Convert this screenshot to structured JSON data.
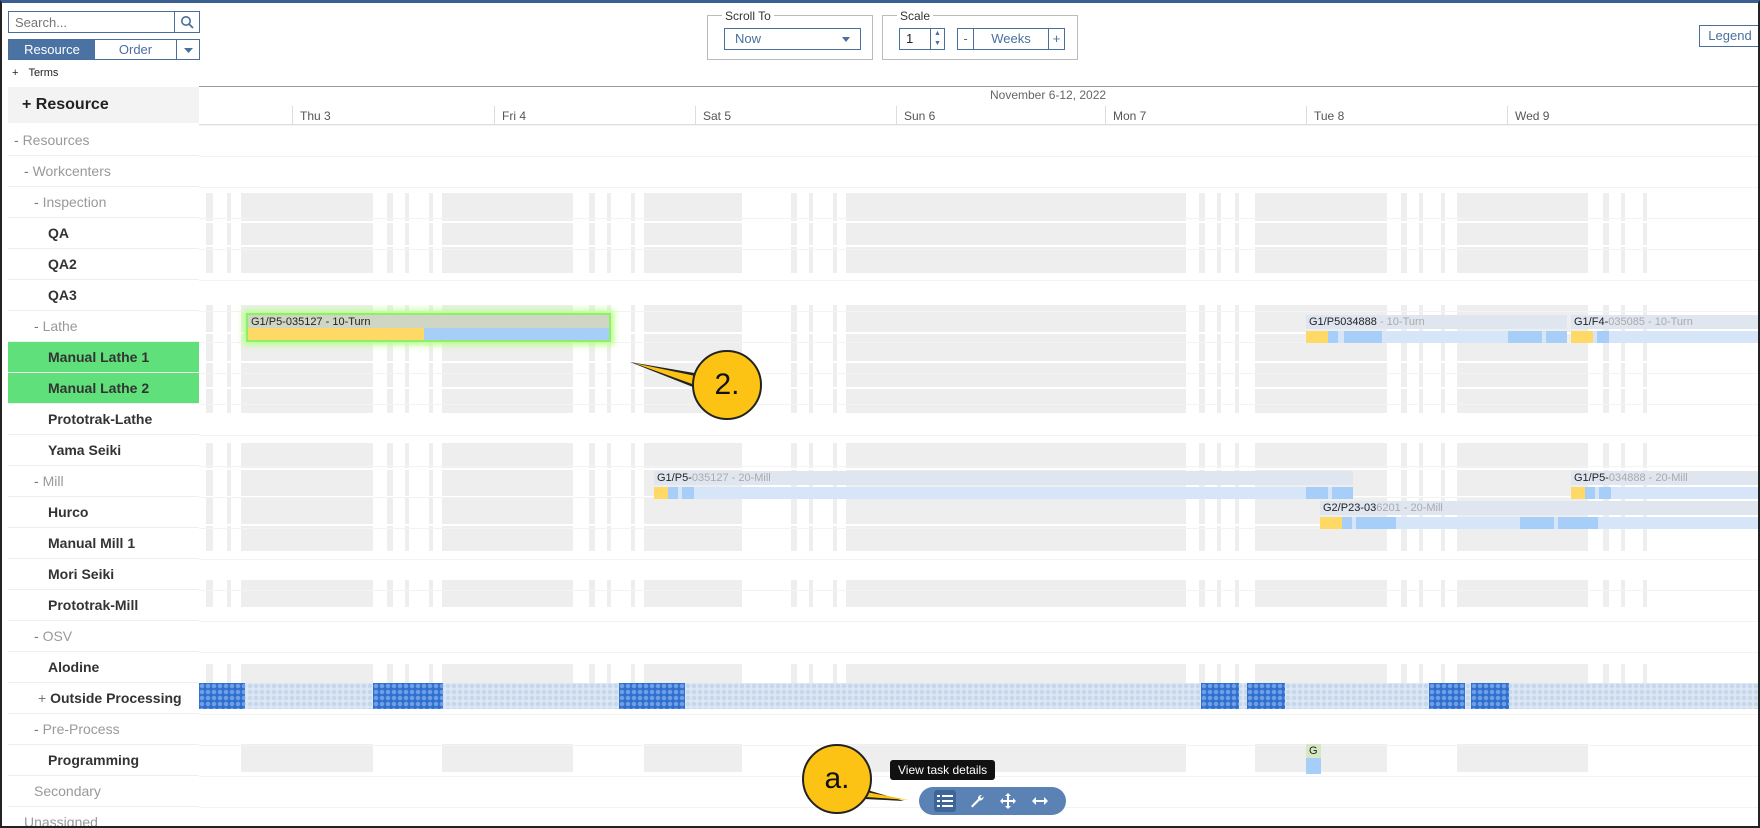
{
  "search": {
    "placeholder": "Search..."
  },
  "view_toggle": {
    "resource_label": "Resource",
    "order_label": "Order"
  },
  "terms_label": "Terms",
  "resource_header": "Resource",
  "tree": [
    {
      "label": "Resources",
      "type": "group",
      "prefix": "-"
    },
    {
      "label": "Workcenters",
      "type": "group",
      "prefix": "-"
    },
    {
      "label": "Inspection",
      "type": "group",
      "prefix": "-"
    },
    {
      "label": "QA",
      "type": "leaf"
    },
    {
      "label": "QA2",
      "type": "leaf"
    },
    {
      "label": "QA3",
      "type": "leaf"
    },
    {
      "label": "Lathe",
      "type": "group",
      "prefix": "-"
    },
    {
      "label": "Manual Lathe 1",
      "type": "leaf",
      "highlighted": true
    },
    {
      "label": "Manual Lathe 2",
      "type": "leaf",
      "highlighted": true
    },
    {
      "label": "Prototrak-Lathe",
      "type": "leaf"
    },
    {
      "label": "Yama Seiki",
      "type": "leaf"
    },
    {
      "label": "Mill",
      "type": "group",
      "prefix": "-"
    },
    {
      "label": "Hurco",
      "type": "leaf"
    },
    {
      "label": "Manual Mill 1",
      "type": "leaf"
    },
    {
      "label": "Mori Seiki",
      "type": "leaf"
    },
    {
      "label": "Prototrak-Mill",
      "type": "leaf"
    },
    {
      "label": "OSV",
      "type": "group",
      "prefix": "-"
    },
    {
      "label": "Alodine",
      "type": "leaf"
    },
    {
      "label": "Outside Processing",
      "type": "leaf",
      "prefix": "+"
    },
    {
      "label": "Pre-Process",
      "type": "group",
      "prefix": "-"
    },
    {
      "label": "Programming",
      "type": "leaf"
    },
    {
      "label": "Secondary",
      "type": "group"
    },
    {
      "label": "Unassigned",
      "type": "group"
    }
  ],
  "scroll_to": {
    "legend": "Scroll To",
    "value": "Now"
  },
  "scale": {
    "legend": "Scale",
    "value": "1",
    "unit": "Weeks",
    "minus": "-",
    "plus": "+"
  },
  "legend_button": "Legend",
  "week_label": "November 6-12, 2022",
  "days": [
    "Thu 3",
    "Fri 4",
    "Sat 5",
    "Sun 6",
    "Mon 7",
    "Tue 8",
    "Wed 9"
  ],
  "tasks": {
    "selected": "G1/P5-035127 - 10-Turn",
    "lathe_t2a": "G1/P5",
    "lathe_t2b": "034888",
    "lathe_t2c": " - 10-Turn",
    "lathe_t3a": "G1/F4-",
    "lathe_t3b": "035085 - 10-Turn",
    "mill_t1a": "G1/P5-",
    "mill_t1b": "035127 - 20-Mill",
    "mill_t2a": "G1/P5-",
    "mill_t2b": "034888 - 20-Mill",
    "mill_t3a": "G2/",
    "mill_t3b": "P23-03",
    "mill_t3c": "6201 - 20-Mill",
    "prog_task": "G"
  },
  "callouts": {
    "two": "2.",
    "a": "a."
  },
  "tooltip": "View task details",
  "toolbar_icons": [
    "list-details-icon",
    "wrench-icon",
    "move-icon",
    "resize-horizontal-icon"
  ],
  "colors": {
    "accent": "#4a73a4",
    "highlight": "#5fe07a",
    "callout": "#fcc315",
    "setup": "#ffd965",
    "run": "#a6cef8"
  }
}
